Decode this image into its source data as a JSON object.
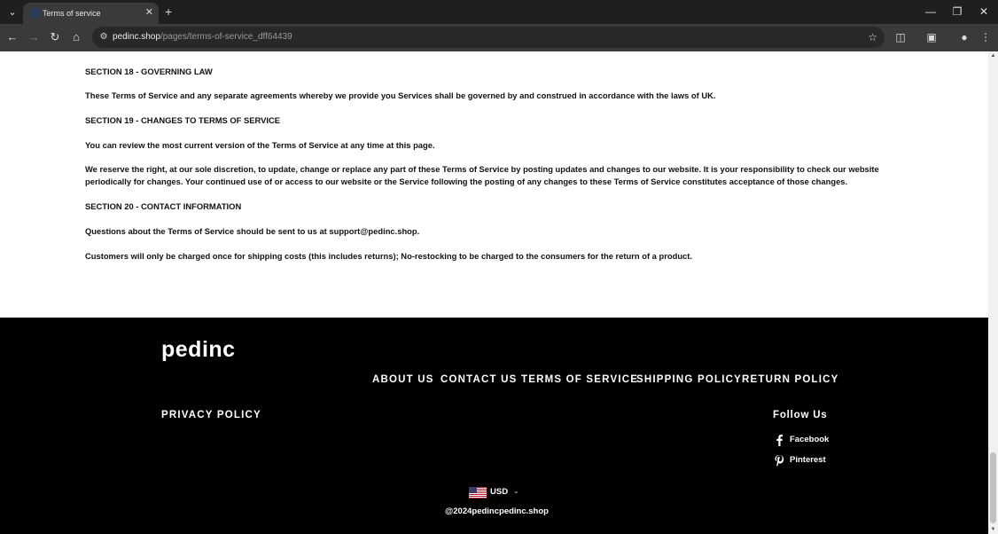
{
  "browser": {
    "tab_title": "Terms of service",
    "url_host": "pedinc.shop",
    "url_path": "/pages/terms-of-service_dff64439"
  },
  "content": {
    "paragraphs": [
      "SECTION 18 - GOVERNING LAW",
      "These Terms of Service and any separate agreements whereby we provide you Services shall be governed by and construed in accordance with the laws of UK.",
      "SECTION 19 - CHANGES TO TERMS OF SERVICE",
      "You can review the most current version of the Terms of Service at any time at this page.",
      "We reserve the right, at our sole discretion, to update, change or replace any part of these Terms of Service by posting updates and changes to our website. It is your responsibility to check our website periodically for changes. Your continued use of or access to our website or the Service following the posting of any changes to these Terms of Service constitutes acceptance of those changes.",
      "SECTION 20 - CONTACT INFORMATION",
      "Questions about the Terms of Service should be sent to us at support@pedinc.shop.",
      "Customers will only be charged once for shipping costs (this includes returns); No-restocking to be charged to the consumers for the return of a product."
    ]
  },
  "footer": {
    "logo": "pedinc",
    "menu": [
      "ABOUT US",
      "CONTACT US",
      "TERMS OF SERVICE",
      "SHIPPING POLICY",
      "RETURN POLICY"
    ],
    "privacy": "PRIVACY POLICY",
    "follow_title": "Follow Us",
    "social": [
      {
        "label": "Facebook",
        "icon": "facebook-icon"
      },
      {
        "label": "Pinterest",
        "icon": "pinterest-icon"
      }
    ],
    "currency": "USD",
    "copyright": "@2024pedincpedinc.shop"
  },
  "colors": {
    "footer_bg": "#000000",
    "page_bg": "#ffffff",
    "text": "#121212"
  }
}
